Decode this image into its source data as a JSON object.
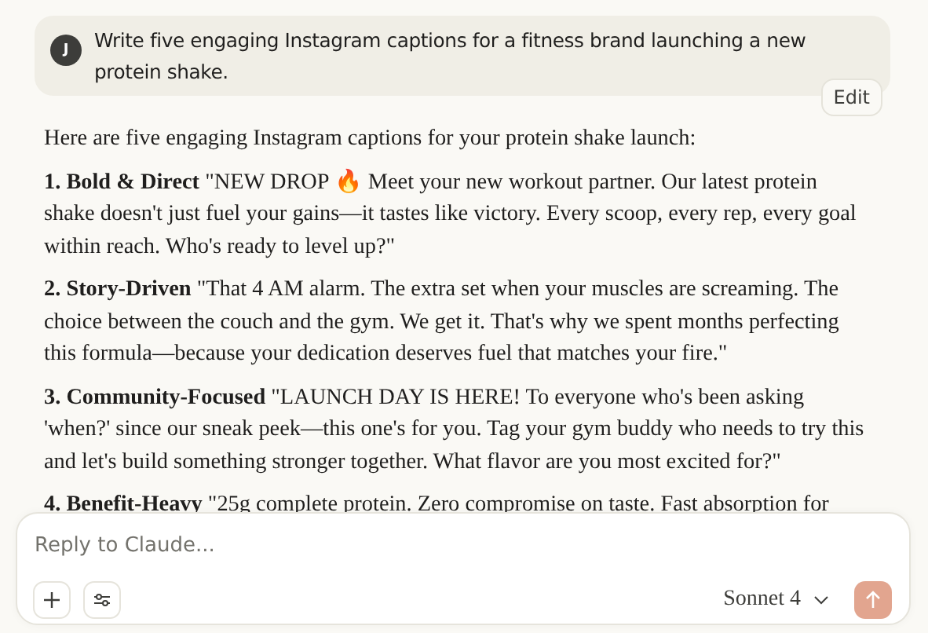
{
  "user_message": {
    "avatar_initial": "J",
    "text": "Write five engaging Instagram captions for a fitness brand launching a new protein shake."
  },
  "edit_button": "Edit",
  "response": {
    "intro": "Here are five engaging Instagram captions for your protein shake launch:",
    "captions": [
      "**1. Bold & Direct** \"NEW DROP 🔥 Meet your new workout partner. Our latest protein shake doesn't just fuel your gains—it tastes like victory. Every scoop, every rep, every goal within reach. Who's ready to level up?\"",
      "**2. Story-Driven** \"That 4 AM alarm. The extra set when your muscles are screaming. The choice between the couch and the gym. We get it. That's why we spent months perfecting this formula—because your dedication deserves fuel that matches your fire.\"",
      "**3. Community-Focused** \"LAUNCH DAY IS HERE! To everyone who's been asking 'when?' since our sneak peek—this one's for you. Tag your gym buddy who needs to try this and let's build something stronger together. What flavor are you most excited for?\"",
      "**4. Benefit-Heavy** \"25g complete protein. Zero compromise on taste. Fast absorption for"
    ]
  },
  "composer": {
    "placeholder": "Reply to Claude...",
    "model": "Sonnet 4"
  }
}
